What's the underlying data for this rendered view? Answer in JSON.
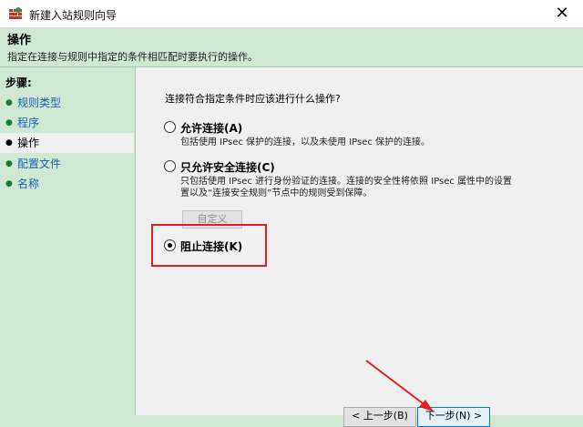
{
  "window": {
    "title": "新建入站规则向导",
    "close_glyph": "✕"
  },
  "header": {
    "title": "操作",
    "description": "指定在连接与规则中指定的条件相匹配时要执行的操作。"
  },
  "sidebar": {
    "title": "步骤:",
    "items": [
      {
        "label": "规则类型",
        "active": false
      },
      {
        "label": "程序",
        "active": false
      },
      {
        "label": "操作",
        "active": true
      },
      {
        "label": "配置文件",
        "active": false
      },
      {
        "label": "名称",
        "active": false
      }
    ]
  },
  "main": {
    "question": "连接符合指定条件时应该进行什么操作?",
    "options": [
      {
        "label": "允许连接(A)",
        "desc_lines": [
          "包括使用 IPsec 保护的连接，以及未使用 IPsec 保护的连接。"
        ],
        "selected": false
      },
      {
        "label": "只允许安全连接(C)",
        "desc_lines": [
          "只包括使用 IPsec 进行身份验证的连接。连接的安全性将依照 IPsec 属性中的设置",
          "置以及“连接安全规则”节点中的规则受到保障。"
        ],
        "selected": false
      },
      {
        "label": "阻止连接(K)",
        "desc_lines": [],
        "selected": true
      }
    ],
    "customize_label": "自定义"
  },
  "footer": {
    "back_label": "< 上一步(B)",
    "next_label": "下一步(N) >"
  },
  "colors": {
    "header_bg": "#cfe8d4",
    "highlight": "#e02020",
    "link": "#1a5fb4"
  }
}
